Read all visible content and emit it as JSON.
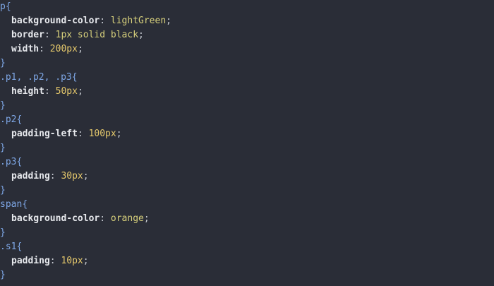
{
  "code": {
    "lines": [
      {
        "type": "selector",
        "selector": "p",
        "open": "{"
      },
      {
        "type": "decl",
        "prop": "background-color",
        "colon": ":",
        "value": "lightGreen",
        "semi": ";"
      },
      {
        "type": "decl",
        "prop": "border",
        "colon": ":",
        "value": "1px solid black",
        "semi": ";"
      },
      {
        "type": "decl",
        "prop": "width",
        "colon": ":",
        "value": "200px",
        "semi": ";"
      },
      {
        "type": "close",
        "text": "}"
      },
      {
        "type": "selector",
        "selector": ".p1, .p2, .p3",
        "open": "{"
      },
      {
        "type": "decl",
        "prop": "height",
        "colon": ":",
        "value": "50px",
        "semi": ";"
      },
      {
        "type": "close",
        "text": "}"
      },
      {
        "type": "selector",
        "selector": ".p2",
        "open": "{"
      },
      {
        "type": "decl",
        "prop": "padding-left",
        "colon": ":",
        "value": "100px",
        "semi": ";"
      },
      {
        "type": "close",
        "text": "}"
      },
      {
        "type": "selector",
        "selector": ".p3",
        "open": "{"
      },
      {
        "type": "decl",
        "prop": "padding",
        "colon": ":",
        "value": "30px",
        "semi": ";"
      },
      {
        "type": "close",
        "text": "}"
      },
      {
        "type": "selector",
        "selector": "span",
        "open": "{"
      },
      {
        "type": "decl",
        "prop": "background-color",
        "colon": ":",
        "value": "orange",
        "semi": ";"
      },
      {
        "type": "close",
        "text": "}"
      },
      {
        "type": "selector",
        "selector": ".s1",
        "open": "{"
      },
      {
        "type": "decl",
        "prop": "padding",
        "colon": ":",
        "value": "10px",
        "semi": ";"
      },
      {
        "type": "close",
        "text": "}"
      }
    ]
  },
  "colors": {
    "background": "#2a2d37",
    "selector": "#7ea7e6",
    "property": "#e6e8ec",
    "value": "#d8d17c"
  }
}
